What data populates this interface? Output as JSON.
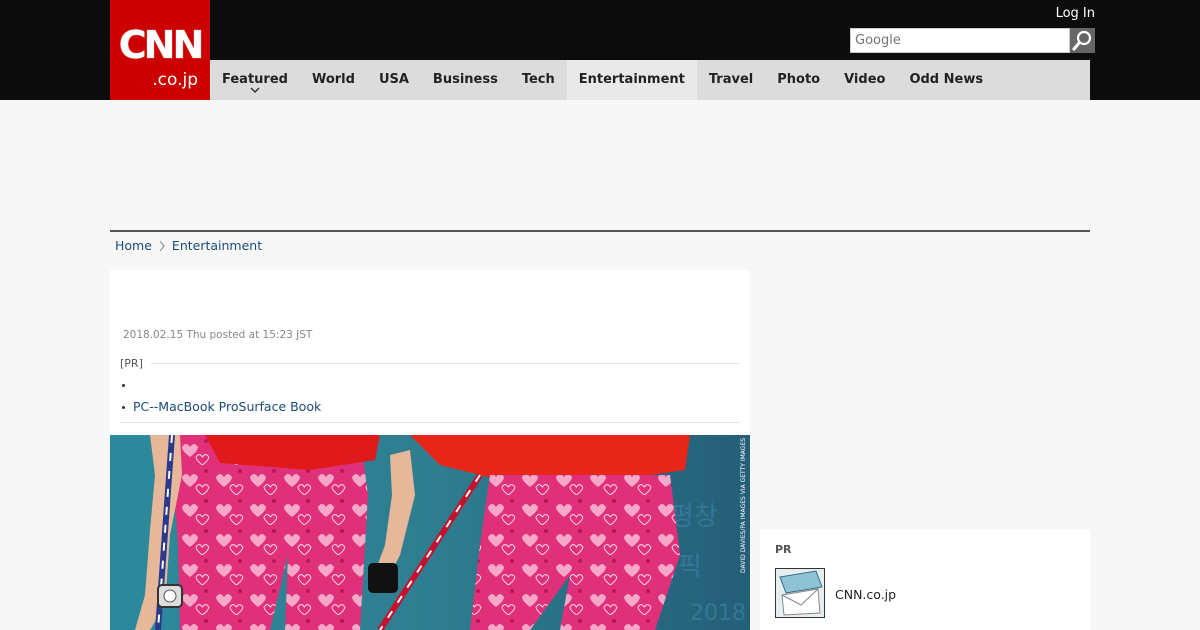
{
  "header": {
    "logo": {
      "line1": "CNN",
      "line2": ".co.jp"
    },
    "login_label": "Log In",
    "search": {
      "placeholder": "Google"
    }
  },
  "nav": {
    "items": [
      {
        "label": "Featured"
      },
      {
        "label": "World"
      },
      {
        "label": "USA"
      },
      {
        "label": "Business"
      },
      {
        "label": "Tech"
      },
      {
        "label": "Entertainment"
      },
      {
        "label": "Travel"
      },
      {
        "label": "Photo"
      },
      {
        "label": "Video"
      },
      {
        "label": "Odd News"
      }
    ],
    "active": "Entertainment"
  },
  "breadcrumb": {
    "home": "Home",
    "section": "Entertainment"
  },
  "article": {
    "posted": "2018.02.15 Thu posted at 15:23 JST",
    "pr": {
      "label": "[PR]",
      "items": [
        "",
        "PC--MacBook ProSurface Book"
      ]
    },
    "photo_credit": "DAVID DAVIES/PA IMAGES VIA GETTY IMAGES"
  },
  "sidebar": {
    "pr_label": "PR",
    "pr_item": {
      "name": "CNN.co.jp"
    }
  },
  "colors": {
    "brand": "#cc0000",
    "topbar": "#0c0c0c",
    "nav_bg": "#dcdcdc",
    "link": "#1a4b7a"
  }
}
